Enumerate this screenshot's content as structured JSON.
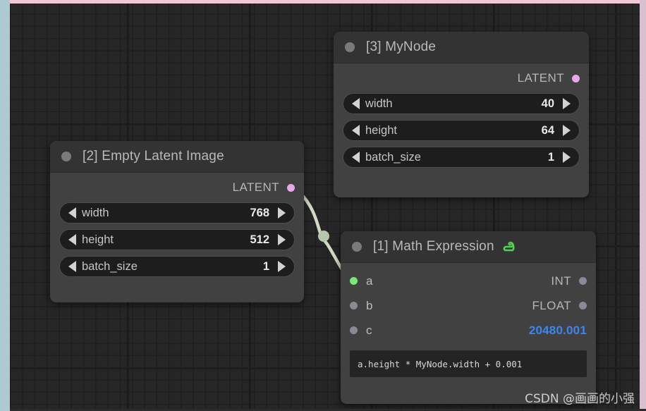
{
  "canvas": {
    "background_color": "#262626",
    "grid_color": "#1e1e1e",
    "edge_left_color": "#aec9d0",
    "edge_top_color": "#f0c8d8",
    "edge_right_color": "#d8c0cf"
  },
  "watermark": {
    "text": "CSDN @画画的小强"
  },
  "links": [
    {
      "name": "latent-link",
      "from_node": "[2] Empty Latent Image",
      "from_slot": "LATENT",
      "to_node": "[1] Math Expression",
      "to_slot": "a",
      "color": "#cfd9c4"
    }
  ],
  "nodes": [
    {
      "id": "mynode",
      "title": "[3] MyNode",
      "collapse_dot": "collapse-dot",
      "has_python_icon": false,
      "outputs": [
        {
          "label": "LATENT",
          "pin_color": "#eaa8ea",
          "connected": false
        }
      ],
      "widgets": [
        {
          "name": "width",
          "value": "40"
        },
        {
          "name": "height",
          "value": "64"
        },
        {
          "name": "batch_size",
          "value": "1"
        }
      ]
    },
    {
      "id": "empty_latent_image",
      "title": "[2] Empty Latent Image",
      "collapse_dot": "collapse-dot",
      "has_python_icon": false,
      "outputs": [
        {
          "label": "LATENT",
          "pin_color": "#eaa8ea",
          "connected": true
        }
      ],
      "widgets": [
        {
          "name": "width",
          "value": "768"
        },
        {
          "name": "height",
          "value": "512"
        },
        {
          "name": "batch_size",
          "value": "1"
        }
      ]
    },
    {
      "id": "math_expression",
      "title": "[1] Math Expression",
      "collapse_dot": "collapse-dot",
      "has_python_icon": true,
      "python_icon_color": "#4fd44f",
      "inputs": [
        {
          "label": "a",
          "pin_color": "#79e879",
          "connected": true
        },
        {
          "label": "b",
          "pin_color": "#8a8a97",
          "connected": false
        },
        {
          "label": "c",
          "pin_color": "#8a8a97",
          "connected": false
        }
      ],
      "outputs": [
        {
          "label": "INT",
          "pin_color": "#8a8a97",
          "value": ""
        },
        {
          "label": "FLOAT",
          "pin_color": "#8a8a97",
          "value": ""
        },
        {
          "label": "",
          "pin_color": "",
          "value": "20480.001",
          "value_color": "#3d86ef"
        }
      ],
      "expression": "a.height * MyNode.width + 0.001"
    }
  ]
}
